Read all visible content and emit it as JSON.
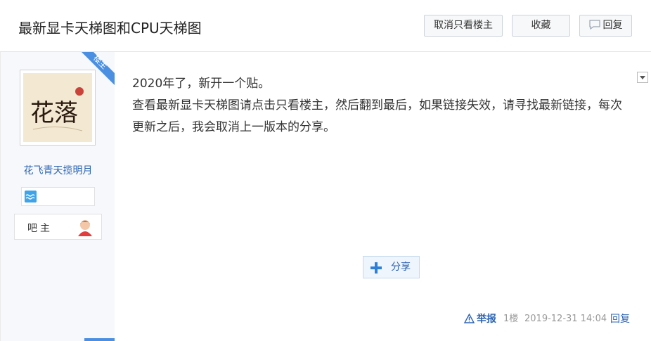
{
  "header": {
    "title": "最新显卡天梯图和CPU天梯图",
    "only_author_label": "取消只看楼主",
    "favorite_label": "收藏",
    "reply_label": "回复",
    "reply_icon": "speech-bubble-icon"
  },
  "sidebar": {
    "badge": "楼主",
    "avatar_text": "花落",
    "username": "花飞青天揽明月",
    "level_icon": "wave-level-icon",
    "role_label": "吧主",
    "role_icon": "bazhu-avatar-icon"
  },
  "post": {
    "lines": [
      "2020年了，新开一个贴。",
      "查看最新显卡天梯图请点击只看楼主，然后翻到最后，如果链接失效，请寻找最新链接，每次更新之后，我会取消上一版本的分享。"
    ],
    "share_label": "分享",
    "share_icon": "plus-icon"
  },
  "footer": {
    "report_label": "举报",
    "report_icon": "warning-icon",
    "floor": "1楼",
    "time": "2019-12-31 14:04",
    "reply_label": "回复"
  },
  "colors": {
    "link": "#2d64b3",
    "badge": "#4a8fe2",
    "sidebar_bg": "#f6f8fb"
  }
}
